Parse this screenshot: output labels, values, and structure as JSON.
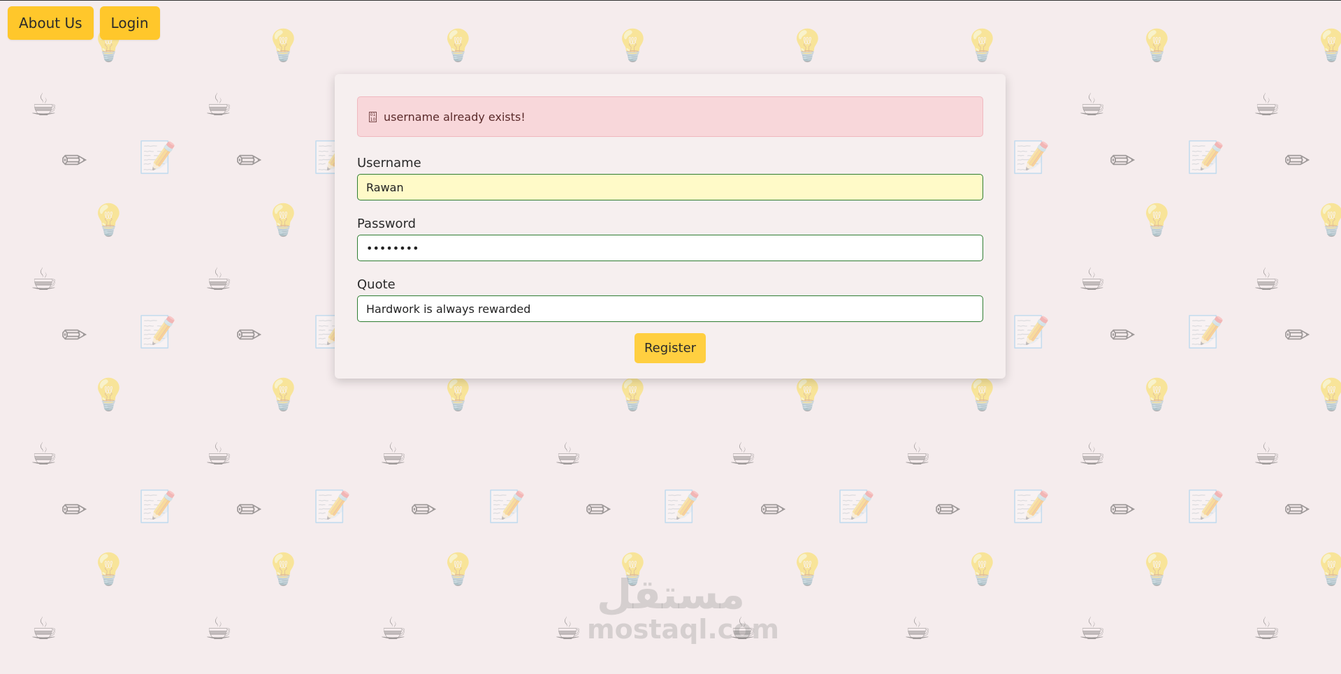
{
  "nav": {
    "about_label": "About Us",
    "login_label": "Login"
  },
  "alert": {
    "icon": "warning-icon",
    "message": "username already exists!"
  },
  "form": {
    "username_label": "Username",
    "username_value": "Rawan",
    "password_label": "Password",
    "password_value": "••••••••",
    "quote_label": "Quote",
    "quote_value": "Hardwork is always rewarded",
    "register_label": "Register"
  },
  "watermark": {
    "arabic": "مستقل",
    "latin": "mostaql.com"
  },
  "colors": {
    "background": "#f5eced",
    "button": "#ffc72b",
    "alert_bg": "#f8d7da",
    "input_border": "#2f7d32",
    "autofill_bg": "#fffac8"
  },
  "background_icons": [
    "lightbulb-icon",
    "coffee-cup-icon",
    "pencil-icon",
    "notepad-icon"
  ]
}
